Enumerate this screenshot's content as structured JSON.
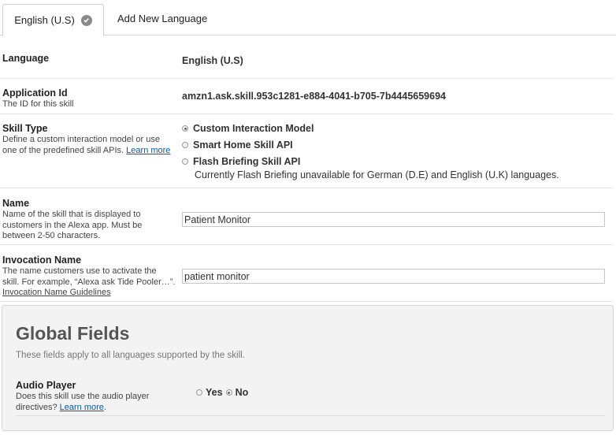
{
  "tabs": {
    "active": "English (U.S)",
    "add": "Add New Language"
  },
  "language": {
    "label": "Language",
    "value": "English (U.S)"
  },
  "app_id": {
    "label": "Application Id",
    "desc": "The ID for this skill",
    "value": "amzn1.ask.skill.953c1281-e884-4041-b705-7b4445659694"
  },
  "skill_type": {
    "label": "Skill Type",
    "desc": "Define a custom interaction model or use one of the predefined skill APIs.",
    "learn_more": "Learn more",
    "options": [
      "Custom Interaction Model",
      "Smart Home Skill API",
      "Flash Briefing Skill API"
    ],
    "selected": "Custom Interaction Model",
    "note": "Currently Flash Briefing unavailable for German (D.E) and English (U.K) languages."
  },
  "name": {
    "label": "Name",
    "desc": "Name of the skill that is displayed to customers in the Alexa app. Must be between 2-50 characters.",
    "value": "Patient Monitor"
  },
  "invocation": {
    "label": "Invocation Name",
    "desc": "The name customers use to activate the skill. For example, “Alexa ask Tide Pooler…”.",
    "guidelines": "Invocation Name Guidelines",
    "value": "patient monitor"
  },
  "global": {
    "title": "Global Fields",
    "subtitle": "These fields apply to all languages supported by the skill.",
    "audio_label": "Audio Player",
    "audio_desc": "Does this skill use the audio player directives?",
    "learn_more": "Learn more",
    "yes": "Yes",
    "no": "No",
    "selected": "No"
  },
  "colors": {
    "link": "#0a5aa8",
    "panel_bg": "#f3f3f3",
    "check_bg": "#8a8a8a"
  },
  "icons": {
    "tab_check": "check-circle-icon"
  }
}
